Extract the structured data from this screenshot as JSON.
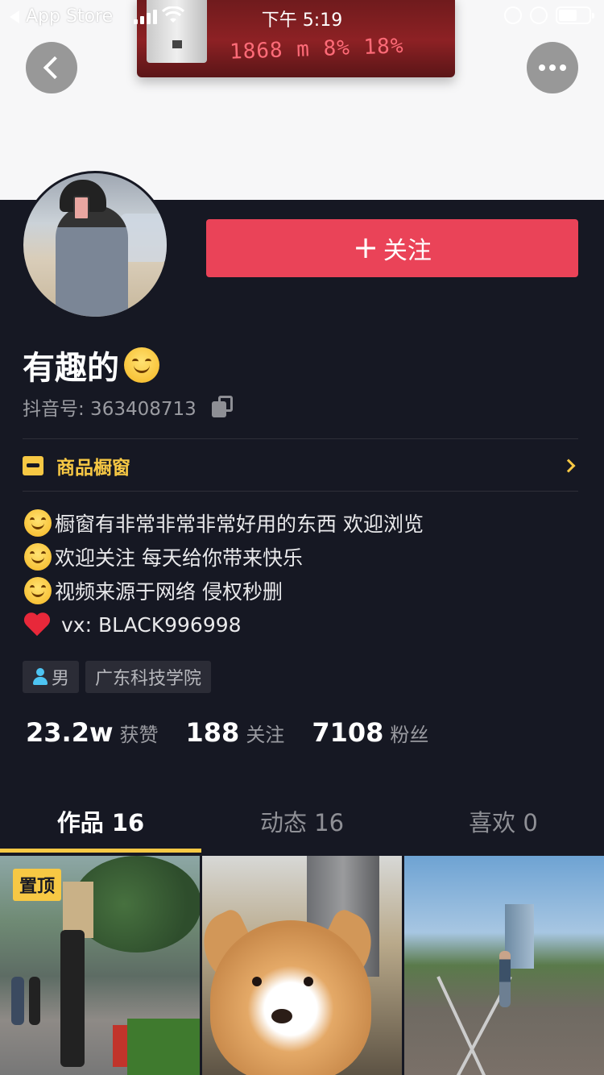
{
  "status_bar": {
    "back_app": "App Store",
    "time": "下午 5:19"
  },
  "banner": {
    "photo_text": "1868 m 8% 18%"
  },
  "profile": {
    "nickname": "有趣的",
    "douyin_id": "抖音号: 363408713",
    "follow_button": "关注"
  },
  "shop": {
    "label": "商品橱窗"
  },
  "bio": [
    "橱窗有非常非常非常好用的东西 欢迎浏览",
    "欢迎关注 每天给你带来快乐",
    "视频来源于网络 侵权秒删",
    "vx:   BLACK996998"
  ],
  "tags": {
    "gender": "男",
    "school": "广东科技学院"
  },
  "stats": [
    {
      "value": "23.2w",
      "label": "获赞"
    },
    {
      "value": "188",
      "label": "关注"
    },
    {
      "value": "7108",
      "label": "粉丝"
    }
  ],
  "tabs": [
    {
      "label": "作品 16",
      "active": true
    },
    {
      "label": "动态 16",
      "active": false
    },
    {
      "label": "喜欢 0",
      "active": false
    }
  ],
  "videos": {
    "pinned_label": "置顶"
  },
  "colors": {
    "background": "#161823",
    "follow": "#ea4358",
    "accent_yellow": "#f7c844"
  }
}
